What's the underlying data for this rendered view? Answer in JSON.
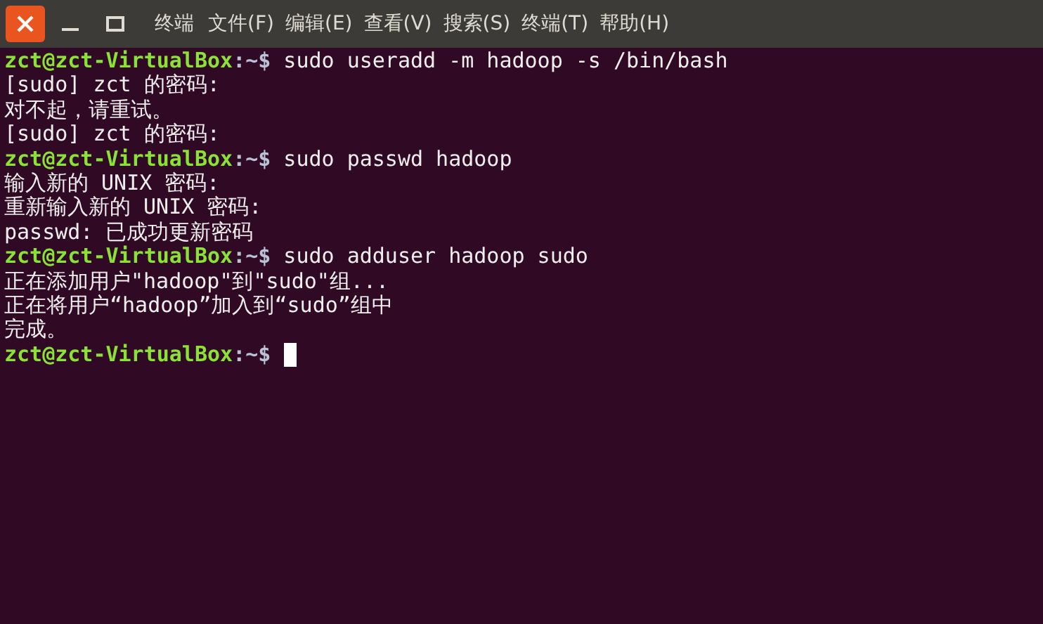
{
  "window": {
    "title": "终端",
    "menus": [
      "文件(F)",
      "编辑(E)",
      "查看(V)",
      "搜索(S)",
      "终端(T)",
      "帮助(H)"
    ]
  },
  "terminal": {
    "lines": [
      {
        "kind": "prompt",
        "host": "zct@zct-VirtualBox",
        "path": ":~$",
        "command": "sudo useradd -m hadoop -s /bin/bash",
        "cursor": false
      },
      {
        "kind": "output",
        "text": "[sudo] zct 的密码:"
      },
      {
        "kind": "output",
        "text": "对不起，请重试。"
      },
      {
        "kind": "output",
        "text": "[sudo] zct 的密码:"
      },
      {
        "kind": "prompt",
        "host": "zct@zct-VirtualBox",
        "path": ":~$",
        "command": "sudo passwd hadoop",
        "cursor": false
      },
      {
        "kind": "output",
        "text": "输入新的 UNIX 密码:"
      },
      {
        "kind": "output",
        "text": "重新输入新的 UNIX 密码:"
      },
      {
        "kind": "output",
        "text": "passwd: 已成功更新密码"
      },
      {
        "kind": "prompt",
        "host": "zct@zct-VirtualBox",
        "path": ":~$",
        "command": "sudo adduser hadoop sudo",
        "cursor": false
      },
      {
        "kind": "output",
        "text": "正在添加用户\"hadoop\"到\"sudo\"组..."
      },
      {
        "kind": "output",
        "text": "正在将用户“hadoop”加入到“sudo”组中"
      },
      {
        "kind": "output",
        "text": "完成。"
      },
      {
        "kind": "prompt",
        "host": "zct@zct-VirtualBox",
        "path": ":~$",
        "cursor": true
      }
    ]
  }
}
